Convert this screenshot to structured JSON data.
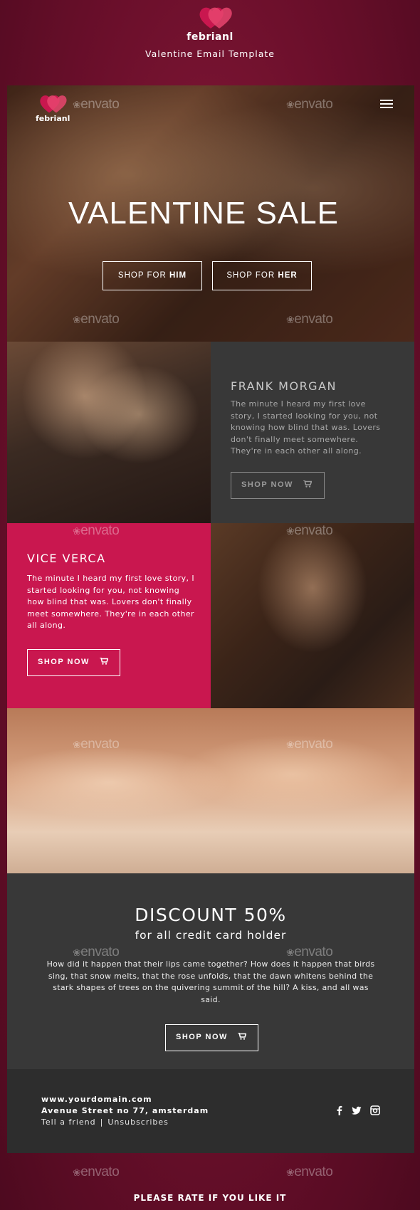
{
  "header": {
    "brand": "febrianl",
    "tagline": "Valentine Email Template"
  },
  "hero": {
    "brand": "febrianl",
    "title": "VALENTINE SALE",
    "btn_him_prefix": "SHOP FOR ",
    "btn_him_bold": "HIM",
    "btn_her_prefix": "SHOP FOR ",
    "btn_her_bold": "HER"
  },
  "card_dark": {
    "title": "FRANK MORGAN",
    "body": "The minute I heard my first love story, I started looking for you, not knowing how blind that was. Lovers don't finally meet somewhere. They're in each other all along.",
    "button": "SHOP NOW"
  },
  "card_pink": {
    "title": "VICE VERCA",
    "body": "The minute I heard my first love story, I started looking for you, not knowing how blind that was. Lovers don't finally meet somewhere. They're in each other all along.",
    "button": "SHOP NOW"
  },
  "discount": {
    "title": "DISCOUNT 50%",
    "subtitle": "for all credit card holder",
    "body": "How did it happen that their lips came together? How does it happen that birds sing, that snow melts, that the rose unfolds, that the dawn whitens behind the stark shapes of trees on the quivering summit of the hill? A kiss, and all was said.",
    "button": "SHOP NOW"
  },
  "footer": {
    "domain": "www.yourdomain.com",
    "address": "Avenue Street no 77, amsterdam",
    "tell_friend": "Tell a friend",
    "separator": "|",
    "unsubscribe": "Unsubscribes"
  },
  "watermark": "envato",
  "bottom_cta": "PLEASE RATE IF YOU LIKE IT",
  "colors": {
    "accent_pink": "#c9174f",
    "card_dark": "#383838",
    "footer": "#2d2d2d",
    "background": "#6b0f2b"
  },
  "icons": [
    "heart-logo-icon",
    "hamburger-menu-icon",
    "cart-icon",
    "facebook-icon",
    "twitter-icon",
    "instagram-icon"
  ]
}
